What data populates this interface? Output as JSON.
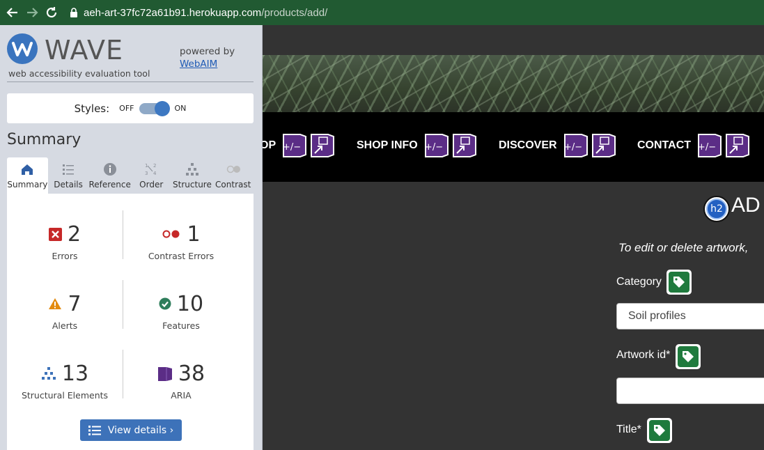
{
  "browser": {
    "url_host": "aeh-art-37fc72a61b91.herokuapp.com",
    "url_path": "/products/add/"
  },
  "wave": {
    "brand": "WAVE",
    "tagline": "web accessibility evaluation tool",
    "powered_by": "powered by",
    "webaim_link": "WebAIM",
    "styles_label": "Styles:",
    "toggle_off": "OFF",
    "toggle_on": "ON",
    "styles_on": true,
    "summary_title": "Summary",
    "tabs": [
      {
        "label": "Summary",
        "icon": "home-icon"
      },
      {
        "label": "Details",
        "icon": "list-icon"
      },
      {
        "label": "Reference",
        "icon": "info-icon"
      },
      {
        "label": "Order",
        "icon": "order-icon"
      },
      {
        "label": "Structure",
        "icon": "structure-icon"
      },
      {
        "label": "Contrast",
        "icon": "contrast-icon"
      }
    ],
    "stats": {
      "errors": {
        "count": "2",
        "label": "Errors"
      },
      "contrast": {
        "count": "1",
        "label": "Contrast Errors"
      },
      "alerts": {
        "count": "7",
        "label": "Alerts"
      },
      "features": {
        "count": "10",
        "label": "Features"
      },
      "structural": {
        "count": "13",
        "label": "Structural Elements"
      },
      "aria": {
        "count": "38",
        "label": "ARIA"
      }
    },
    "view_details": "View details ›"
  },
  "page": {
    "nav": [
      {
        "label": "OP"
      },
      {
        "label": "SHOP INFO"
      },
      {
        "label": "DISCOVER"
      },
      {
        "label": "CONTACT"
      }
    ],
    "heading": "AD",
    "heading_badge": "h2",
    "edit_note": "To edit or delete artwork,",
    "fields": {
      "category_label": "Category",
      "category_value": "Soil profiles",
      "artwork_id_label": "Artwork id*",
      "artwork_id_value": "",
      "title_label": "Title*"
    }
  },
  "colors": {
    "wave_blue": "#3d72b9",
    "error_red": "#c62828",
    "alert_orange": "#e38b0f",
    "feature_green": "#2e7d5b",
    "aria_purple": "#5b2d86",
    "browser_bar": "#215a32"
  }
}
